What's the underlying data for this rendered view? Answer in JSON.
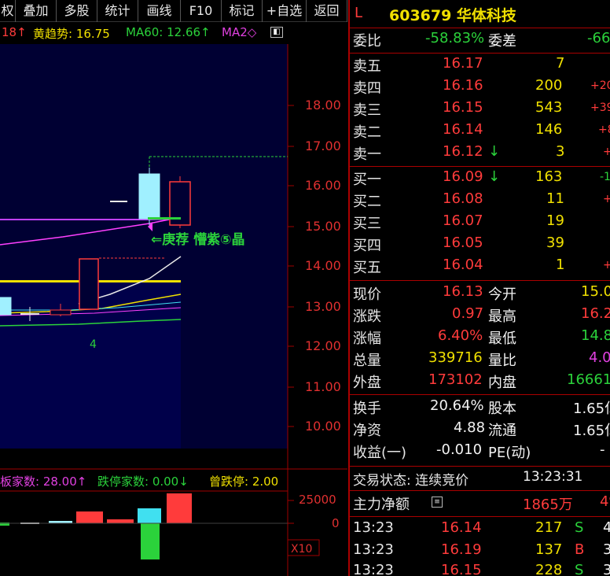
{
  "toolbar": {
    "items": [
      "权",
      "叠加",
      "多股",
      "统计",
      "画线",
      "F10",
      "标记",
      "+自选",
      "返回"
    ]
  },
  "indicators": {
    "prefix": "18↑",
    "huang_label": "黄趋势: 16.75",
    "ma60_label": "MA60: 12.66↑",
    "ma2_label": "MA2◇"
  },
  "chart": {
    "price_ticks": [
      "18.00",
      "17.00",
      "16.00",
      "15.00",
      "14.00",
      "13.00",
      "12.00",
      "11.00",
      "10.00"
    ],
    "annotation": "⇐庚荐 懵紫⑤晶",
    "count_label": "4"
  },
  "volume": {
    "header_a": "板家数: 28.00↑",
    "header_b": "跌停家数: 0.00↓",
    "header_c": "曾跌停: 2.00",
    "tick_top": "25000",
    "tick_zero": "0",
    "scale_label": "X10"
  },
  "quote": {
    "flag": "L",
    "code_name": "603679 华体科技",
    "weibi_label": "委比",
    "weibi_value": "-58.83%",
    "weicha_label": "委差",
    "weicha_value": "-66",
    "asks": [
      {
        "label": "卖五",
        "price": "16.17",
        "vol": "7",
        "chg": ""
      },
      {
        "label": "卖四",
        "price": "16.16",
        "vol": "200",
        "chg": "+20"
      },
      {
        "label": "卖三",
        "price": "16.15",
        "vol": "543",
        "chg": "+39"
      },
      {
        "label": "卖二",
        "price": "16.14",
        "vol": "146",
        "chg": "+8"
      },
      {
        "label": "卖一",
        "price": "16.12",
        "arrow": "↓",
        "vol": "3",
        "chg": "+"
      }
    ],
    "bids": [
      {
        "label": "买一",
        "price": "16.09",
        "arrow": "↓",
        "vol": "163",
        "chg": "-1"
      },
      {
        "label": "买二",
        "price": "16.08",
        "vol": "11",
        "chg": "+"
      },
      {
        "label": "买三",
        "price": "16.07",
        "vol": "19",
        "chg": ""
      },
      {
        "label": "买四",
        "price": "16.05",
        "vol": "39",
        "chg": ""
      },
      {
        "label": "买五",
        "price": "16.04",
        "vol": "1",
        "chg": "+"
      }
    ],
    "stats": {
      "xianjia_label": "现价",
      "xianjia": "16.13",
      "jinkai_label": "今开",
      "jinkai": "15.0",
      "zhangdie_label": "涨跌",
      "zhangdie": "0.97",
      "zuigao_label": "最高",
      "zuigao": "16.2",
      "zhangfu_label": "涨幅",
      "zhangfu": "6.40%",
      "zuidi_label": "最低",
      "zuidi": "14.8",
      "zongliang_label": "总量",
      "zongliang": "339716",
      "liangbi_label": "量比",
      "liangbi": "4.0",
      "waipan_label": "外盘",
      "waipan": "173102",
      "neipan_label": "内盘",
      "neipan": "16661"
    },
    "fund": {
      "huanshou_label": "换手",
      "huanshou": "20.64%",
      "guben_label": "股本",
      "guben": "1.65亿",
      "jingzi_label": "净资",
      "jingzi": "4.88",
      "liutong_label": "流通",
      "liutong": "1.65亿",
      "shouyi_label": "收益(一)",
      "shouyi": "-0.010",
      "pe_label": "PE(动)",
      "pe": "-"
    },
    "status_label": "交易状态: 连续竞价",
    "status_time": "13:23:31",
    "zhuli_label": "主力净额",
    "zhuli_value": "1865万",
    "zhuli_pct": "4%",
    "ticks": [
      {
        "time": "13:23",
        "price": "16.14",
        "vol": "217",
        "side": "S",
        "extra": "4"
      },
      {
        "time": "13:23",
        "price": "16.19",
        "vol": "137",
        "side": "B",
        "extra": "3"
      },
      {
        "time": "13:23",
        "price": "16.15",
        "vol": "228",
        "side": "S",
        "extra": "3"
      }
    ]
  },
  "colors": {
    "chart_bg": "#000033",
    "up": "#ff3b3b",
    "down": "#40e0f0",
    "grid_red": "#a00000",
    "yellow": "#f0e000",
    "green": "#2bd23b",
    "magenta": "#e040e0"
  }
}
